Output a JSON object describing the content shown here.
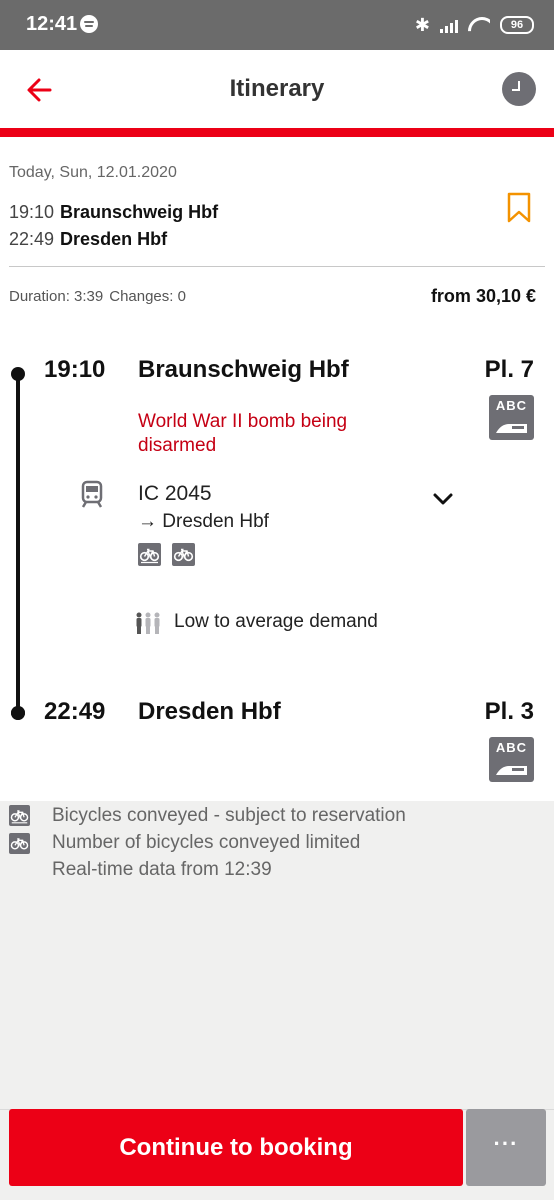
{
  "status_bar": {
    "time": "12:41",
    "battery": "96",
    "icons": [
      "spotify-icon",
      "bluetooth-icon",
      "signal-icon",
      "wifi-icon",
      "battery-icon"
    ]
  },
  "app_bar": {
    "title": "Itinerary",
    "back_icon": "arrow-left-icon",
    "action_icon": "clock-icon",
    "accent_color": "#ec0016"
  },
  "trip": {
    "date": "Today, Sun, 12.01.2020",
    "departure_time": "19:10",
    "departure_station": "Braunschweig Hbf",
    "arrival_time": "22:49",
    "arrival_station": "Dresden Hbf",
    "duration": "Duration: 3:39",
    "changes": "Changes: 0",
    "price": "from 30,10 €",
    "bookmark_color": "#f39200"
  },
  "journey": {
    "stops": [
      {
        "time": "19:10",
        "station": "Braunschweig Hbf",
        "platform": "Pl. 7",
        "icon_text": "ABC"
      },
      {
        "time": "22:49",
        "station": "Dresden Hbf",
        "platform": "Pl. 3",
        "icon_text": "ABC"
      }
    ],
    "disruption": "World War II bomb being disarmed",
    "disruption_color": "#c50014",
    "train": "IC 2045",
    "direction": "Dresden Hbf",
    "direction_arrow": "→",
    "bike_chips": [
      "bicycle-icon",
      "bicycle-icon"
    ],
    "demand": "Low to average demand"
  },
  "notes": [
    {
      "icon": "bicycle-icon",
      "text": "Bicycles conveyed - subject to reservation"
    },
    {
      "icon": "bicycle-icon",
      "text": "Number of bicycles conveyed limited"
    },
    {
      "icon": "",
      "text": "Real-time data from 12:39"
    }
  ],
  "footer": {
    "continue_label": "Continue to booking",
    "more_label": "···"
  }
}
